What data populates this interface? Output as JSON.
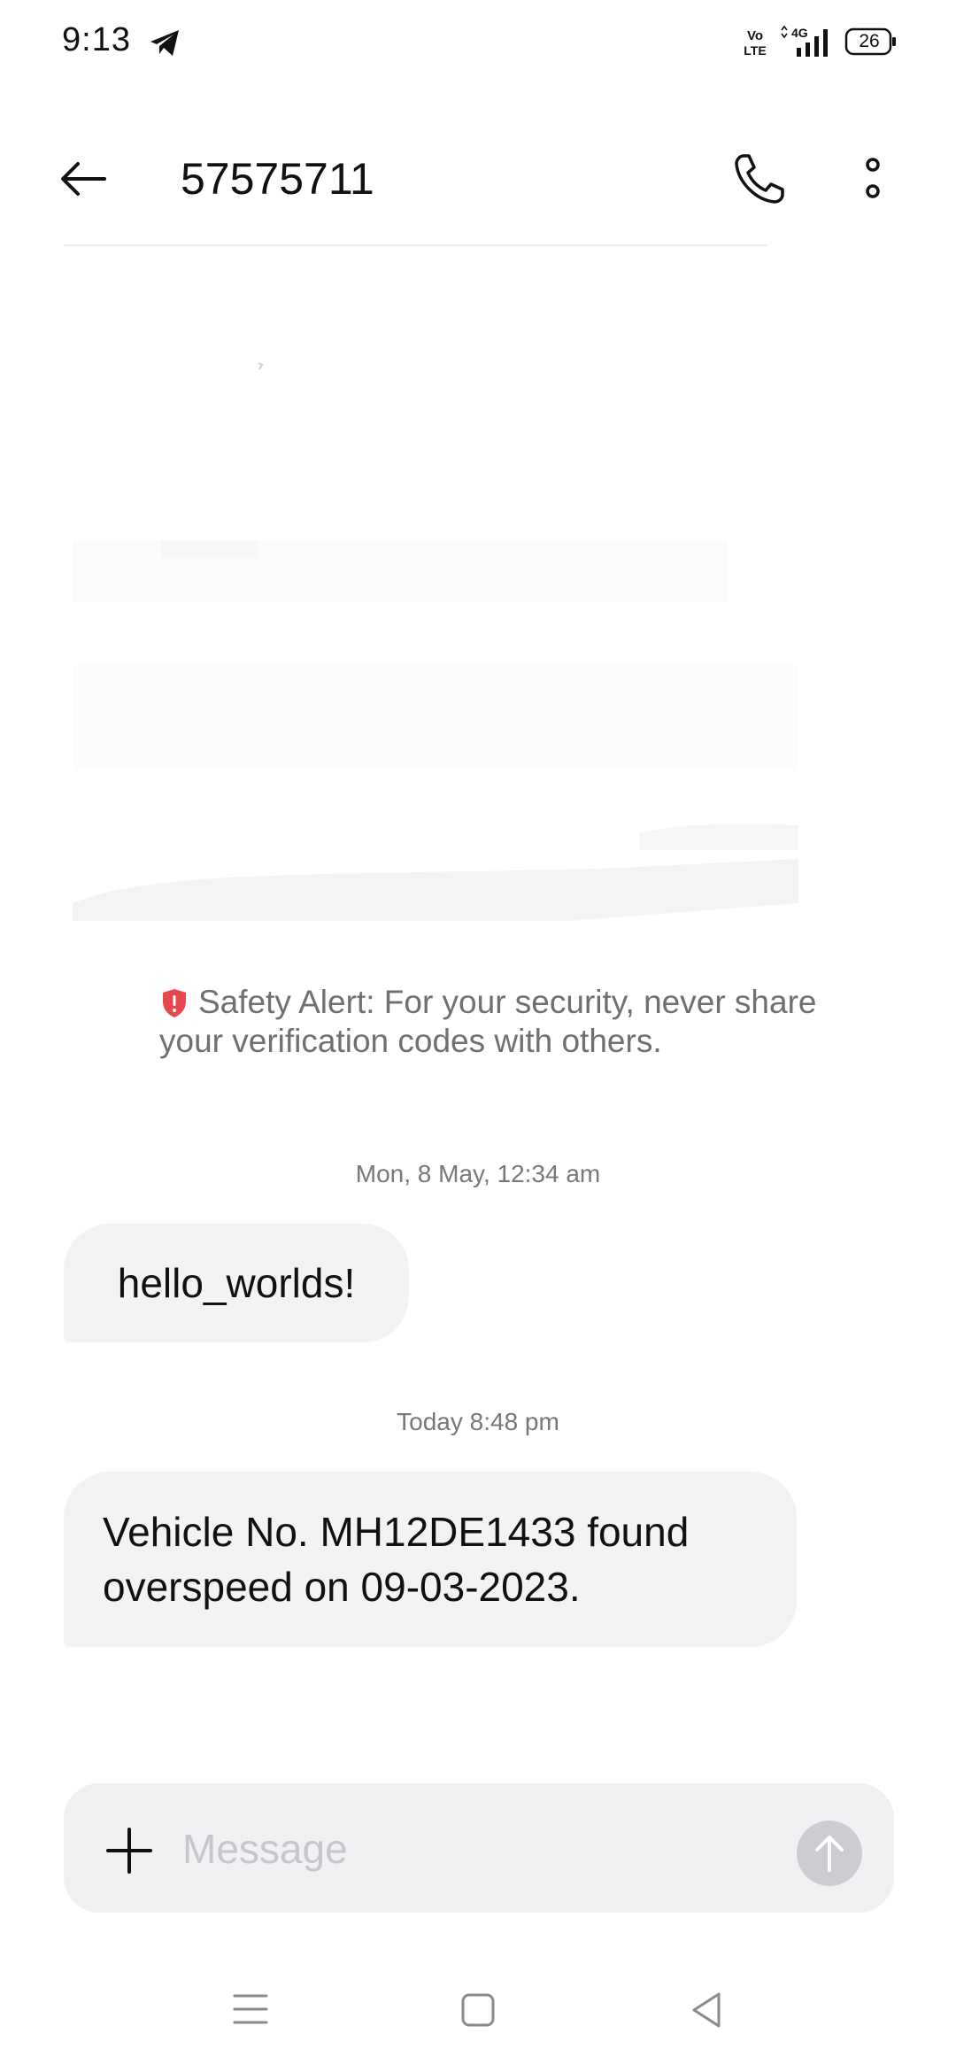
{
  "status_bar": {
    "time": "9:13",
    "network_label": "Vo LTE",
    "network_type": "4G",
    "battery": "26"
  },
  "header": {
    "title": "57575711",
    "back_icon": "arrow-left-icon",
    "call_icon": "phone-icon",
    "more_icon": "more-vertical-icon"
  },
  "safety_alert": {
    "icon": "shield-alert-icon",
    "text": "Safety Alert: For your security, never share your verification codes with others.",
    "icon_color": "#e5484d"
  },
  "messages": [
    {
      "timestamp": "Mon, 8 May, 12:34 am",
      "text": "hello_worlds!"
    },
    {
      "timestamp": "Today 8:48 pm",
      "text": "Vehicle No. MH12DE1433 found overspeed on 09-03-2023."
    }
  ],
  "composer": {
    "placeholder": "Message",
    "value": "",
    "add_icon": "plus-icon",
    "send_icon": "arrow-up-icon"
  },
  "nav_bar": {
    "icons": [
      "menu-icon",
      "home-square-icon",
      "back-triangle-icon"
    ]
  },
  "colors": {
    "bubble": "#f3f3f5",
    "composer": "#f1f1f3",
    "send_button": "#cdcdd1",
    "secondary_text": "#6f6f74"
  }
}
